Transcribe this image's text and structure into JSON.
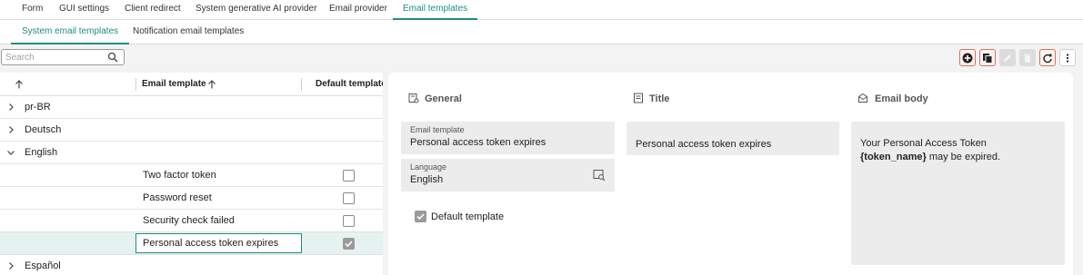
{
  "top_tabs": [
    "Form",
    "GUI settings",
    "Client redirect",
    "System generative AI provider",
    "Email provider",
    "Email templates"
  ],
  "sub_tabs": [
    "System email templates",
    "Notification email templates"
  ],
  "search": {
    "placeholder": "Search",
    "value": ""
  },
  "toolbar": {
    "buttons": [
      "add-icon",
      "copy-icon",
      "edit-icon",
      "delete-icon",
      "refresh-icon",
      "more-icon"
    ],
    "accent": "#d9705a"
  },
  "grid": {
    "columns": [
      "Email template",
      "Default template"
    ],
    "rows": [
      {
        "type": "group",
        "label": "pr-BR",
        "expanded": false
      },
      {
        "type": "group",
        "label": "Deutsch",
        "expanded": false
      },
      {
        "type": "group",
        "label": "English",
        "expanded": true
      },
      {
        "type": "item",
        "label": "Two factor token",
        "default": false
      },
      {
        "type": "item",
        "label": "Password reset",
        "default": false
      },
      {
        "type": "item",
        "label": "Security check failed",
        "default": false
      },
      {
        "type": "item",
        "label": "Personal access token expires",
        "default": true,
        "selected": true
      },
      {
        "type": "group",
        "label": "Español",
        "expanded": false
      }
    ]
  },
  "detail": {
    "general": {
      "title": "General",
      "email_template_label": "Email template",
      "email_template_value": "Personal access token expires",
      "language_label": "Language",
      "language_value": "English",
      "default_template_label": "Default template",
      "default_template_checked": true
    },
    "title_section": {
      "title": "Title",
      "value": "Personal access token expires"
    },
    "body_section": {
      "title": "Email body",
      "line1": "Your Personal Access Token",
      "token": "{token_name}",
      "line2_rest": " may be expired."
    }
  },
  "colors": {
    "accent": "#1e8f7e",
    "selected_row": "#e6f2ef",
    "field_bg": "#ececec"
  }
}
